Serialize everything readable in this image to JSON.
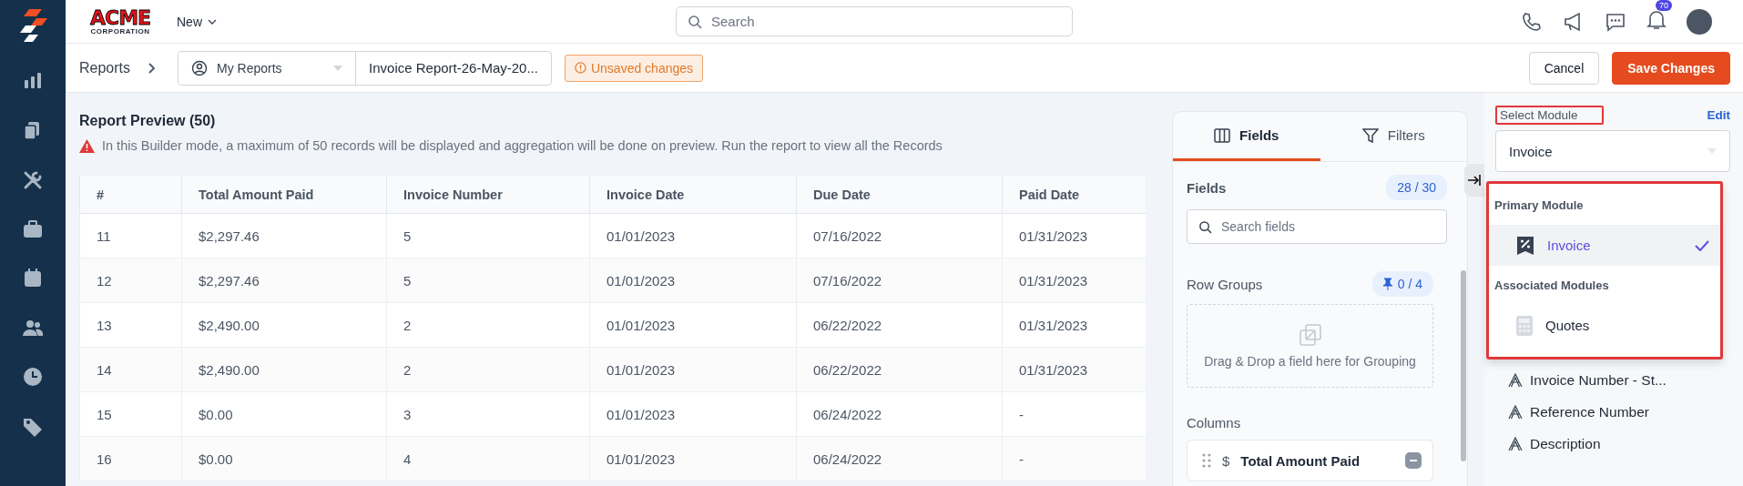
{
  "logo": {
    "name": "ACME",
    "sub": "CORPORATION"
  },
  "top_bar": {
    "new_menu": "New",
    "search": {
      "placeholder": "Search"
    },
    "notification_count": "70"
  },
  "toolbar": {
    "breadcrumb": "Reports",
    "folder": "My Reports",
    "report_name": "Invoice Report-26-May-20...",
    "unsaved_badge": "Unsaved changes",
    "buttons": [
      {
        "label": "Cancel",
        "kind": "secondary"
      },
      {
        "label": "Save Changes",
        "kind": "primary"
      }
    ]
  },
  "preview": {
    "title": "Report Preview (50)",
    "warning": "In this Builder mode, a maximum of 50 records will be displayed and aggregation will be done on preview. Run the report to view all the Records",
    "table": {
      "columns": [
        "#",
        "Total Amount Paid",
        "Invoice Number",
        "Invoice Date",
        "Due Date",
        "Paid Date"
      ],
      "rows": [
        [
          "11",
          "$2,297.46",
          "5",
          "01/01/2023",
          "07/16/2022",
          "01/31/2023"
        ],
        [
          "12",
          "$2,297.46",
          "5",
          "01/01/2023",
          "07/16/2022",
          "01/31/2023"
        ],
        [
          "13",
          "$2,490.00",
          "2",
          "01/01/2023",
          "06/22/2022",
          "01/31/2023"
        ],
        [
          "14",
          "$2,490.00",
          "2",
          "01/01/2023",
          "06/22/2022",
          "01/31/2023"
        ],
        [
          "15",
          "$0.00",
          "3",
          "01/01/2023",
          "06/24/2022",
          "-"
        ],
        [
          "16",
          "$0.00",
          "4",
          "01/01/2023",
          "06/24/2022",
          "-"
        ]
      ]
    }
  },
  "fields_panel": {
    "tabs": [
      {
        "label": "Fields",
        "selected": true
      },
      {
        "label": "Filters",
        "selected": false
      }
    ],
    "fields_heading": "Fields",
    "fields_count": "28 / 30",
    "search": {
      "placeholder": "Search fields"
    },
    "row_groups": {
      "title": "Row Groups",
      "count": "0 / 4",
      "drop_hint": "Drag & Drop a field here for Grouping"
    },
    "columns": {
      "title": "Columns",
      "items": [
        {
          "symbol": "$",
          "label": "Total Amount Paid"
        }
      ]
    }
  },
  "module_panel": {
    "label": "Select Module",
    "edit": "Edit",
    "value": "Invoice",
    "menu": {
      "groups": [
        {
          "title": "Primary Module",
          "items": [
            {
              "label": "Invoice",
              "selected": true
            }
          ]
        },
        {
          "title": "Associated Modules",
          "items": [
            {
              "label": "Quotes",
              "selected": false
            }
          ]
        }
      ]
    },
    "fields": [
      "Invoice Number - St...",
      "Reference Number",
      "Description"
    ]
  }
}
